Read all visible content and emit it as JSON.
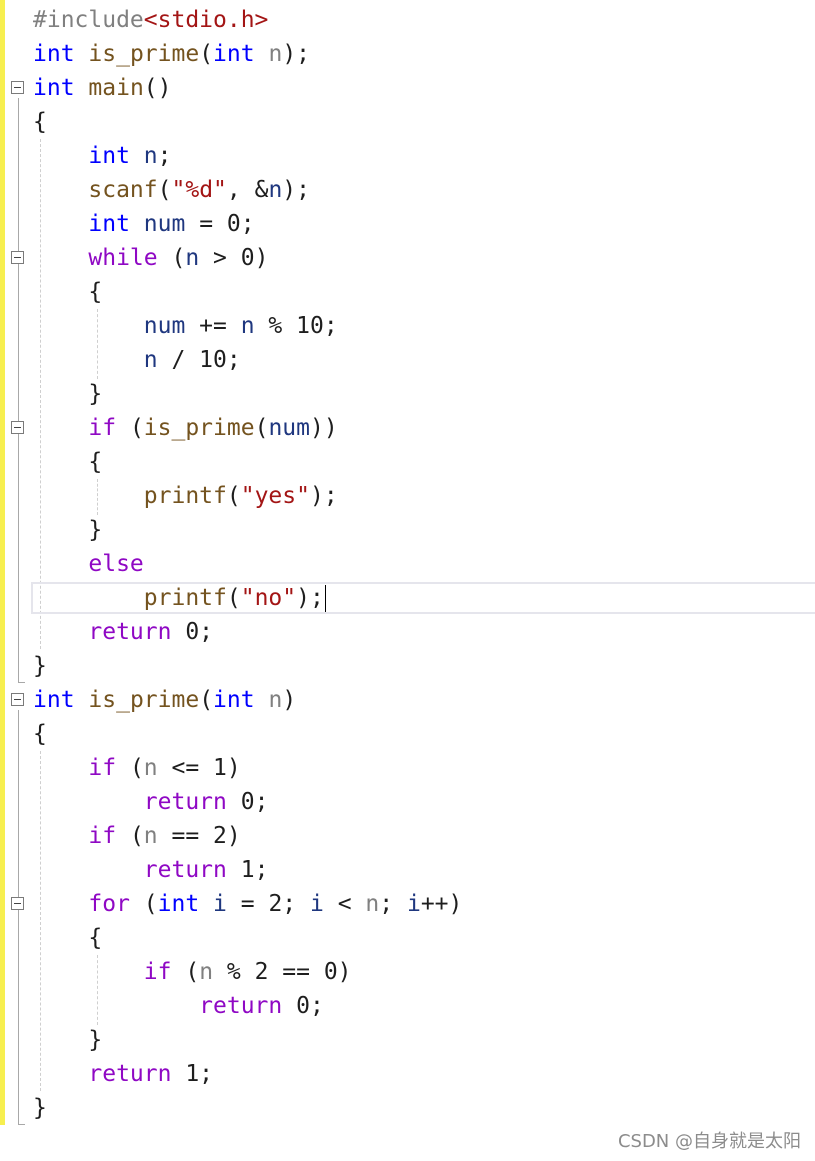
{
  "editor": {
    "lines": [
      [
        {
          "t": "#include",
          "c": "pre"
        },
        {
          "t": "<stdio.h>",
          "c": "hdr"
        }
      ],
      [
        {
          "t": "int",
          "c": "k"
        },
        {
          "t": " "
        },
        {
          "t": "is_prime",
          "c": "f"
        },
        {
          "t": "("
        },
        {
          "t": "int",
          "c": "k"
        },
        {
          "t": " "
        },
        {
          "t": "n",
          "c": "p"
        },
        {
          "t": ");"
        }
      ],
      [
        {
          "t": "int",
          "c": "k"
        },
        {
          "t": " "
        },
        {
          "t": "main",
          "c": "f"
        },
        {
          "t": "()"
        }
      ],
      [
        {
          "t": "{"
        }
      ],
      [
        {
          "t": "    "
        },
        {
          "t": "int",
          "c": "k"
        },
        {
          "t": " "
        },
        {
          "t": "n",
          "c": "v"
        },
        {
          "t": ";"
        }
      ],
      [
        {
          "t": "    "
        },
        {
          "t": "scanf",
          "c": "f"
        },
        {
          "t": "("
        },
        {
          "t": "\"%d\"",
          "c": "s"
        },
        {
          "t": ", &"
        },
        {
          "t": "n",
          "c": "v"
        },
        {
          "t": ");"
        }
      ],
      [
        {
          "t": "    "
        },
        {
          "t": "int",
          "c": "k"
        },
        {
          "t": " "
        },
        {
          "t": "num",
          "c": "v"
        },
        {
          "t": " = 0;"
        }
      ],
      [
        {
          "t": "    "
        },
        {
          "t": "while",
          "c": "c"
        },
        {
          "t": " ("
        },
        {
          "t": "n",
          "c": "v"
        },
        {
          "t": " > 0)"
        }
      ],
      [
        {
          "t": "    {"
        }
      ],
      [
        {
          "t": "        "
        },
        {
          "t": "num",
          "c": "v"
        },
        {
          "t": " += "
        },
        {
          "t": "n",
          "c": "v"
        },
        {
          "t": " % 10;"
        }
      ],
      [
        {
          "t": "        "
        },
        {
          "t": "n",
          "c": "v"
        },
        {
          "t": " / 10;"
        }
      ],
      [
        {
          "t": "    }"
        }
      ],
      [
        {
          "t": "    "
        },
        {
          "t": "if",
          "c": "c"
        },
        {
          "t": " ("
        },
        {
          "t": "is_prime",
          "c": "f"
        },
        {
          "t": "("
        },
        {
          "t": "num",
          "c": "v"
        },
        {
          "t": "))"
        }
      ],
      [
        {
          "t": "    {"
        }
      ],
      [
        {
          "t": "        "
        },
        {
          "t": "printf",
          "c": "f"
        },
        {
          "t": "("
        },
        {
          "t": "\"yes\"",
          "c": "s"
        },
        {
          "t": ");"
        }
      ],
      [
        {
          "t": "    }"
        }
      ],
      [
        {
          "t": "    "
        },
        {
          "t": "else",
          "c": "c"
        }
      ],
      [
        {
          "t": "        "
        },
        {
          "t": "printf",
          "c": "f"
        },
        {
          "t": "("
        },
        {
          "t": "\"no\"",
          "c": "s"
        },
        {
          "t": ");"
        }
      ],
      [
        {
          "t": "    "
        },
        {
          "t": "return",
          "c": "c"
        },
        {
          "t": " 0;"
        }
      ],
      [
        {
          "t": "}"
        }
      ],
      [
        {
          "t": "int",
          "c": "k"
        },
        {
          "t": " "
        },
        {
          "t": "is_prime",
          "c": "f"
        },
        {
          "t": "("
        },
        {
          "t": "int",
          "c": "k"
        },
        {
          "t": " "
        },
        {
          "t": "n",
          "c": "p"
        },
        {
          "t": ")"
        }
      ],
      [
        {
          "t": "{"
        }
      ],
      [
        {
          "t": "    "
        },
        {
          "t": "if",
          "c": "c"
        },
        {
          "t": " ("
        },
        {
          "t": "n",
          "c": "p"
        },
        {
          "t": " <= 1)"
        }
      ],
      [
        {
          "t": "        "
        },
        {
          "t": "return",
          "c": "c"
        },
        {
          "t": " 0;"
        }
      ],
      [
        {
          "t": "    "
        },
        {
          "t": "if",
          "c": "c"
        },
        {
          "t": " ("
        },
        {
          "t": "n",
          "c": "p"
        },
        {
          "t": " == 2)"
        }
      ],
      [
        {
          "t": "        "
        },
        {
          "t": "return",
          "c": "c"
        },
        {
          "t": " 1;"
        }
      ],
      [
        {
          "t": "    "
        },
        {
          "t": "for",
          "c": "c"
        },
        {
          "t": " ("
        },
        {
          "t": "int",
          "c": "k"
        },
        {
          "t": " "
        },
        {
          "t": "i",
          "c": "v"
        },
        {
          "t": " = 2; "
        },
        {
          "t": "i",
          "c": "v"
        },
        {
          "t": " < "
        },
        {
          "t": "n",
          "c": "p"
        },
        {
          "t": "; "
        },
        {
          "t": "i",
          "c": "v"
        },
        {
          "t": "++)"
        }
      ],
      [
        {
          "t": "    {"
        }
      ],
      [
        {
          "t": "        "
        },
        {
          "t": "if",
          "c": "c"
        },
        {
          "t": " ("
        },
        {
          "t": "n",
          "c": "p"
        },
        {
          "t": " % 2 == 0)"
        }
      ],
      [
        {
          "t": "            "
        },
        {
          "t": "return",
          "c": "c"
        },
        {
          "t": " 0;"
        }
      ],
      [
        {
          "t": "    }"
        }
      ],
      [
        {
          "t": "    "
        },
        {
          "t": "return",
          "c": "c"
        },
        {
          "t": " 1;"
        }
      ],
      [
        {
          "t": "}"
        }
      ]
    ],
    "current_line": 17,
    "fold_lines": [
      2,
      7,
      12,
      20,
      26
    ],
    "colors": {
      "keyword": "#0000ff",
      "control": "#8f08c4",
      "function": "#74531f",
      "local_variable": "#1f377f",
      "parameter": "#808080",
      "string": "#a31515",
      "preprocessor": "#808080",
      "change_bar": "#f7ef4f"
    }
  },
  "watermark": "CSDN @自身就是太阳"
}
